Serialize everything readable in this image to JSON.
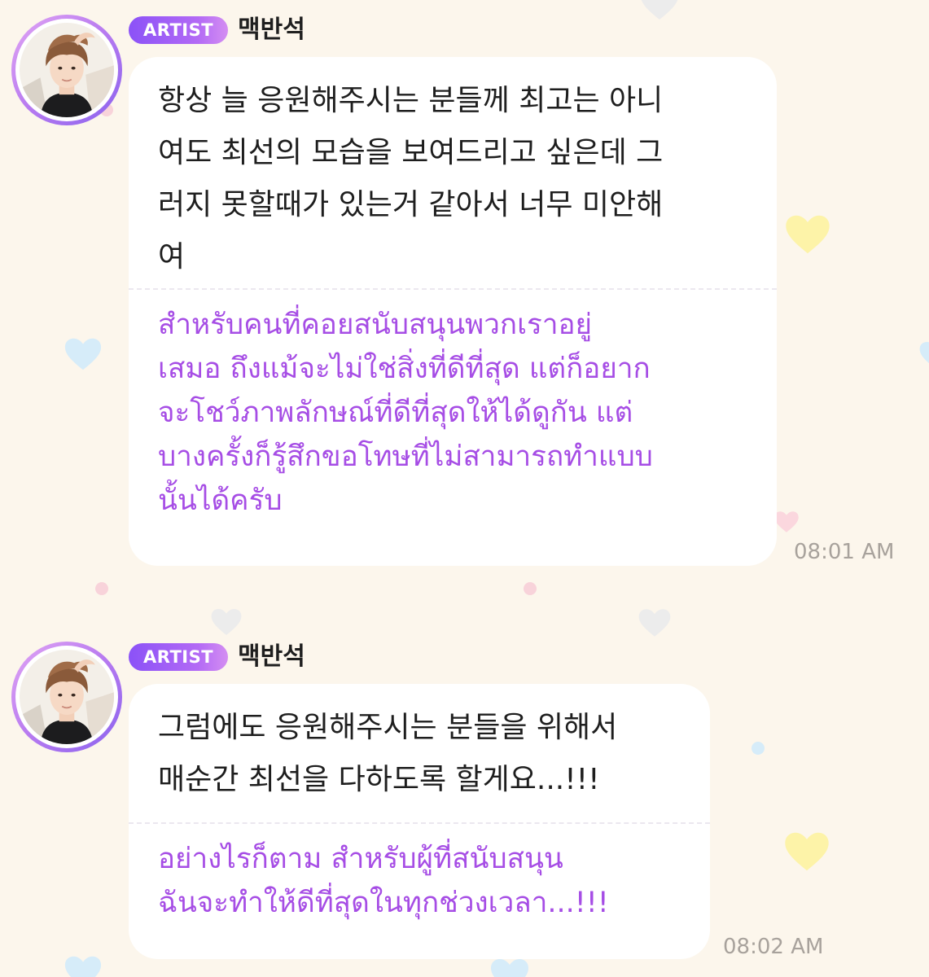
{
  "messages": [
    {
      "badge": "ARTIST",
      "name": "맥반석",
      "korean": "항상 늘 응원해주시는 분들께 최고는 아니\n여도 최선의 모습을 보여드리고 싶은데 그\n러지 못할때가 있는거 같아서 너무 미안해\n여",
      "thai": "สำหรับคนที่คอยสนับสนุนพวกเราอยู่\nเสมอ ถึงแม้จะไม่ใช่สิ่งที่ดีที่สุด แต่ก็อยาก\nจะโชว์ภาพลักษณ์ที่ดีที่สุดให้ได้ดูกัน แต่\nบางครั้งก็รู้สึกขอโทษที่ไม่สามารถทำแบบ\nนั้นได้ครับ",
      "time": "08:01 AM"
    },
    {
      "badge": "ARTIST",
      "name": "맥반석",
      "korean": "그럼에도 응원해주시는 분들을 위해서\n매순간 최선을 다하도록 할게요...!!!",
      "thai": "อย่างไรก็ตาม สำหรับผู้ที่สนับสนุน\nฉันจะทำให้ดีที่สุดในทุกช่วงเวลา...!!!",
      "time": "08:02 AM"
    }
  ],
  "colors": {
    "background": "#fcf6ec",
    "bubble": "#ffffff",
    "translation_text": "#a64de5",
    "badge_start": "#8b52f7",
    "badge_end": "#d48ef2",
    "timestamp": "#a8a29c"
  },
  "icons": [
    "heart-icon",
    "dot-icon",
    "avatar-photo"
  ]
}
